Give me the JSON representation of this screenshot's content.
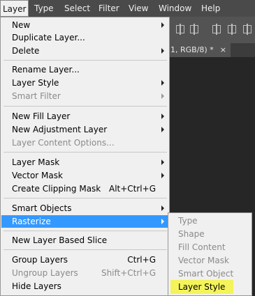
{
  "menubar": {
    "items": [
      "Layer",
      "Type",
      "Select",
      "Filter",
      "View",
      "Window",
      "Help"
    ]
  },
  "document": {
    "tab_title": "1, RGB/8) *",
    "close_glyph": "×"
  },
  "layer_menu": {
    "items": [
      {
        "label": "New",
        "submenu": true
      },
      {
        "label": "Duplicate Layer..."
      },
      {
        "label": "Delete",
        "submenu": true
      },
      {
        "label": "Rename Layer..."
      },
      {
        "label": "Layer Style",
        "submenu": true
      },
      {
        "label": "Smart Filter",
        "submenu": true,
        "disabled": true
      },
      {
        "label": "New Fill Layer",
        "submenu": true
      },
      {
        "label": "New Adjustment Layer",
        "submenu": true
      },
      {
        "label": "Layer Content Options...",
        "disabled": true
      },
      {
        "label": "Layer Mask",
        "submenu": true
      },
      {
        "label": "Vector Mask",
        "submenu": true
      },
      {
        "label": "Create Clipping Mask",
        "shortcut": "Alt+Ctrl+G"
      },
      {
        "label": "Smart Objects",
        "submenu": true
      },
      {
        "label": "Rasterize",
        "submenu": true,
        "highlighted": true
      },
      {
        "label": "New Layer Based Slice"
      },
      {
        "label": "Group Layers",
        "shortcut": "Ctrl+G"
      },
      {
        "label": "Ungroup Layers",
        "shortcut": "Shift+Ctrl+G",
        "disabled": true
      },
      {
        "label": "Hide Layers"
      }
    ]
  },
  "rasterize_submenu": {
    "items": [
      {
        "label": "Type",
        "disabled": true
      },
      {
        "label": "Shape",
        "disabled": true
      },
      {
        "label": "Fill Content",
        "disabled": true
      },
      {
        "label": "Vector Mask",
        "disabled": true
      },
      {
        "label": "Smart Object",
        "disabled": true
      },
      {
        "label": "Layer Style",
        "disabled": false,
        "marked": true
      }
    ],
    "marker_color": "#f4f35a"
  },
  "colors": {
    "menu_highlight": "#3399ff",
    "menubar_bg": "#4a4a4a",
    "menu_bg": "#f0f0f0"
  }
}
